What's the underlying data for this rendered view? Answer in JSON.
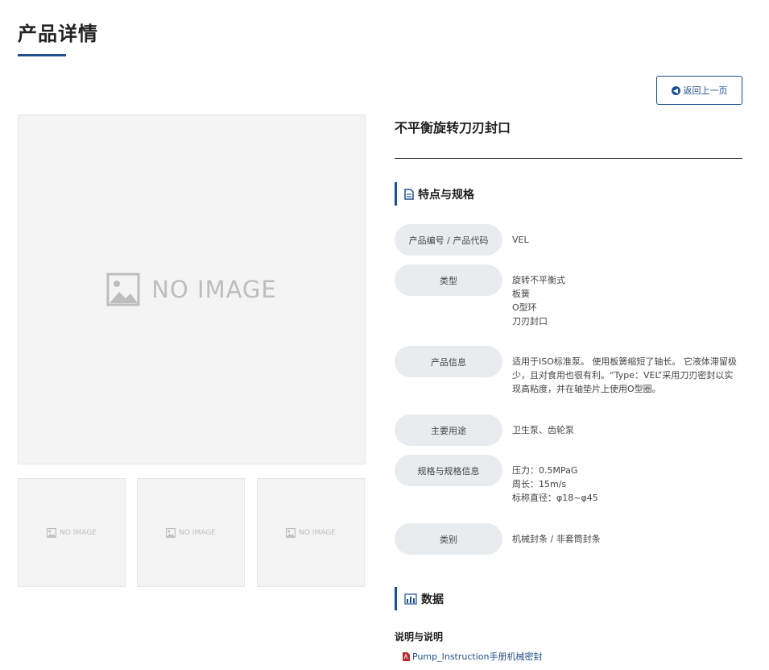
{
  "page": {
    "title": "产品详情"
  },
  "back_button": {
    "label": "返回上一页"
  },
  "gallery": {
    "no_image_text": "NO IMAGE"
  },
  "product": {
    "name": "不平衡旋转刀刃封口"
  },
  "specs_section": {
    "title": "特点与规格"
  },
  "specs": [
    {
      "label": "产品编号 / 产品代码",
      "lines": [
        "VEL"
      ]
    },
    {
      "label": "类型",
      "lines": [
        "旋转不平衡式",
        "板簧",
        "O型环",
        "刀刃封口"
      ]
    },
    {
      "label": "产品信息",
      "lines": [
        "适用于ISO标准泵。 使用板簧缩短了轴长。 它液体滞留极",
        "少，且对食用也很有利。“Type：VEL”采用刀刃密封以实",
        "现高粘度，并在轴垫片上使用O型圈。"
      ]
    },
    {
      "label": "主要用途",
      "lines": [
        "卫生泵、齿轮泵"
      ]
    },
    {
      "label": "规格与规格信息",
      "lines": [
        "压力：0.5MPaG",
        "周长：15m/s",
        "标称直径：φ18~φ45"
      ]
    },
    {
      "label": "类别",
      "lines": [
        "机械封条 / 非套筒封条"
      ]
    }
  ],
  "data_section": {
    "title": "数据",
    "subheading": "说明与说明",
    "file_link": "Pump_Instruction手册机械密封"
  },
  "colors": {
    "accent": "#1d4f91",
    "label_bg": "#e9ecef",
    "placeholder_bg": "#f4f4f4",
    "pdf_red": "#c62828"
  }
}
